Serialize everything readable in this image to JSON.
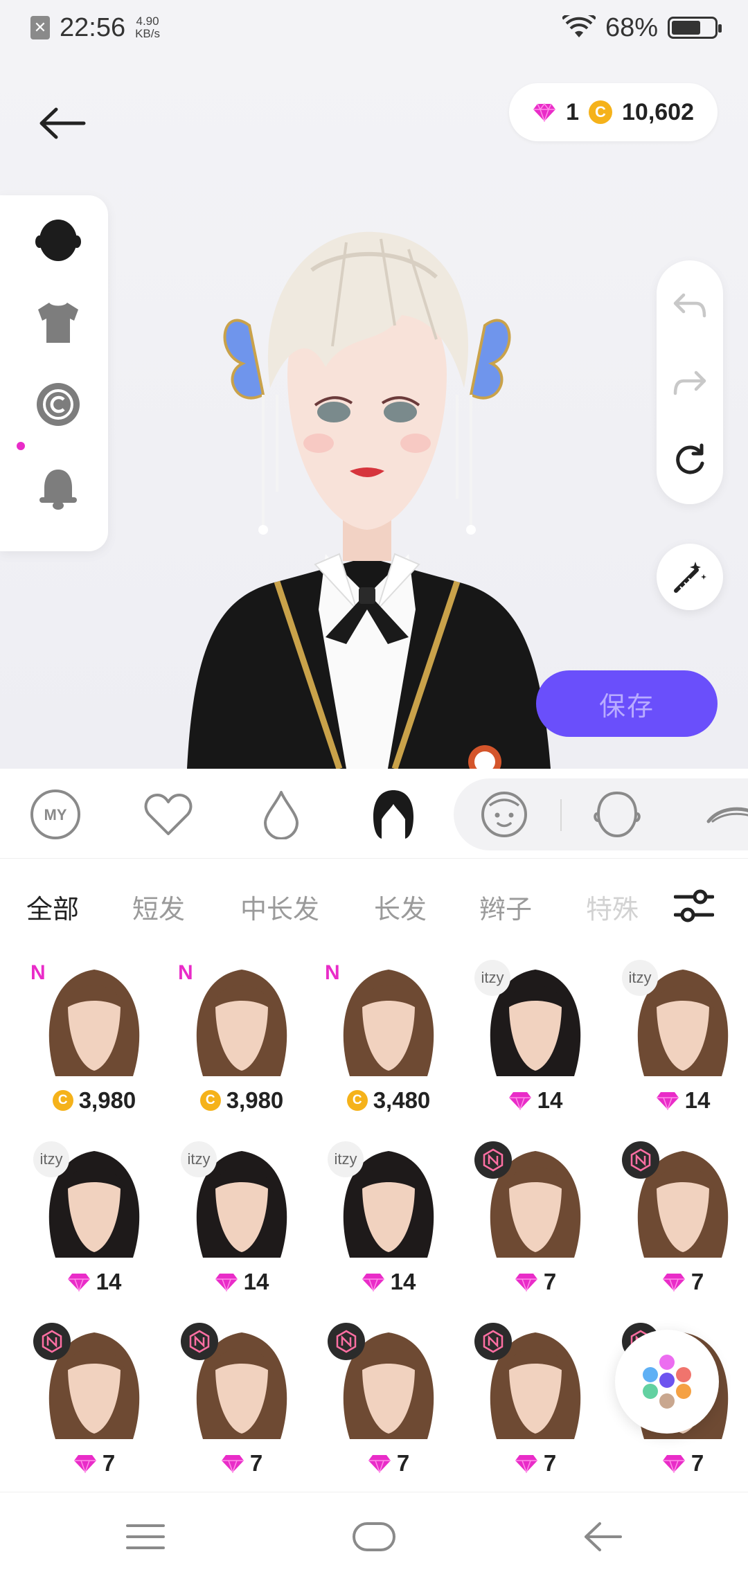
{
  "status_bar": {
    "time": "22:56",
    "net_speed_value": "4.90",
    "net_speed_unit": "KB/s",
    "battery_percent": "68%",
    "battery_level": 0.68
  },
  "header": {
    "gem_count": "1",
    "coin_count": "10,602"
  },
  "side_panel": {
    "items": [
      {
        "icon": "head-icon"
      },
      {
        "icon": "shirt-icon"
      },
      {
        "icon": "copyright-icon"
      },
      {
        "icon": "bell-icon"
      }
    ]
  },
  "stage": {
    "save_label": "保存"
  },
  "categories": [
    {
      "icon": "my-icon",
      "label": "MY"
    },
    {
      "icon": "heart-icon"
    },
    {
      "icon": "drop-icon"
    },
    {
      "icon": "hair-icon"
    },
    {
      "icon": "face-icon"
    },
    {
      "icon": "head-outline-icon"
    },
    {
      "icon": "eyebrow-icon"
    }
  ],
  "sub_tabs": [
    {
      "label": "全部",
      "active": true
    },
    {
      "label": "短发"
    },
    {
      "label": "中长发"
    },
    {
      "label": "长发"
    },
    {
      "label": "辫子"
    },
    {
      "label": "特殊"
    }
  ],
  "colors": {
    "accent": "#6a4ffb",
    "gem": "#e92cc8",
    "coin": "#f5b21a",
    "hair_brown": "#6e4a33",
    "hair_black": "#1e1a1a",
    "skin": "#f1d2bf"
  },
  "items": [
    {
      "badge": "N",
      "currency": "coin",
      "price": "3,980",
      "hair": "brown"
    },
    {
      "badge": "N",
      "currency": "coin",
      "price": "3,980",
      "hair": "brown"
    },
    {
      "badge": "N",
      "currency": "coin",
      "price": "3,480",
      "hair": "brown"
    },
    {
      "badge": "itzy",
      "currency": "gem",
      "price": "14",
      "hair": "black"
    },
    {
      "badge": "itzy",
      "currency": "gem",
      "price": "14",
      "hair": "brown"
    },
    {
      "badge": "itzy",
      "currency": "gem",
      "price": "14",
      "hair": "black"
    },
    {
      "badge": "itzy",
      "currency": "gem",
      "price": "14",
      "hair": "black"
    },
    {
      "badge": "itzy",
      "currency": "gem",
      "price": "14",
      "hair": "black"
    },
    {
      "badge": "nmixx",
      "currency": "gem",
      "price": "7",
      "hair": "brown"
    },
    {
      "badge": "nmixx",
      "currency": "gem",
      "price": "7",
      "hair": "brown"
    },
    {
      "badge": "nmixx",
      "currency": "gem",
      "price": "7",
      "hair": "brown"
    },
    {
      "badge": "nmixx",
      "currency": "gem",
      "price": "7",
      "hair": "brown"
    },
    {
      "badge": "nmixx",
      "currency": "gem",
      "price": "7",
      "hair": "brown"
    },
    {
      "badge": "nmixx",
      "currency": "gem",
      "price": "7",
      "hair": "brown"
    },
    {
      "badge": "nmixx",
      "currency": "gem",
      "price": "7",
      "hair": "brown"
    }
  ]
}
